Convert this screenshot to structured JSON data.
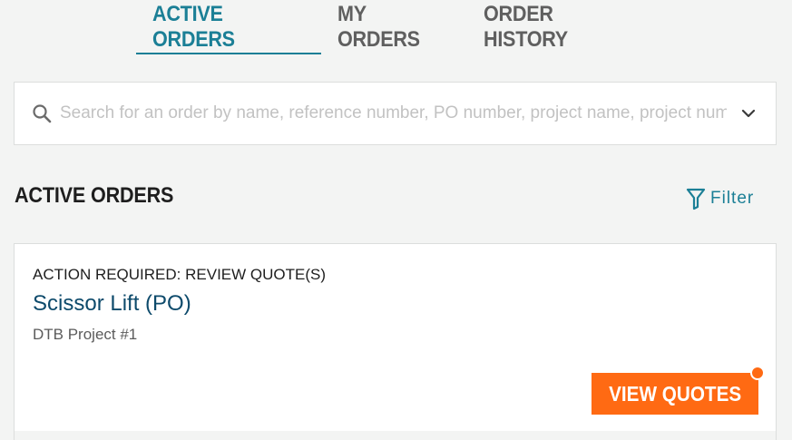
{
  "tabs": [
    {
      "label": "ACTIVE ORDERS",
      "active": true
    },
    {
      "label": "MY ORDERS",
      "active": false
    },
    {
      "label": "ORDER HISTORY",
      "active": false
    }
  ],
  "search": {
    "placeholder": "Search for an order by name, reference number, PO number, project name, project number",
    "value": "",
    "icon": "search-icon",
    "dropdown_icon": "chevron-down-icon"
  },
  "section": {
    "title": "ACTIVE ORDERS",
    "filter_label": "Filter",
    "filter_icon": "filter-icon"
  },
  "orders": [
    {
      "status": "ACTION REQUIRED: REVIEW QUOTE(S)",
      "title": "Scissor Lift (PO)",
      "project": "DTB Project #1",
      "action_label": "VIEW QUOTES",
      "has_notification": true
    }
  ],
  "colors": {
    "accent": "#1b7f96",
    "title_link": "#0d4a6b",
    "cta": "#ff6a13",
    "background": "#f3f4f3"
  }
}
